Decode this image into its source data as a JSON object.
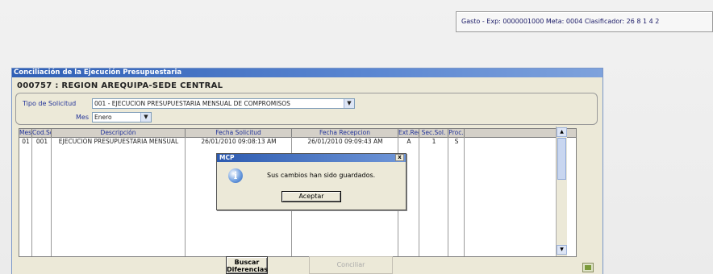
{
  "status_bar": {
    "text": "Gasto - Exp: 0000001000 Meta: 0004 Clasificador: 26 8 1 4 2"
  },
  "window": {
    "title": "Conciliación de la Ejecución Presupuestaria",
    "org_title": "000757 : REGION AREQUIPA-SEDE CENTRAL"
  },
  "filters": {
    "tipo_label": "Tipo de Solicitud",
    "tipo_value": "001 - EJECUCION PRESUPUESTARIA MENSUAL DE COMPROMISOS",
    "mes_label": "Mes",
    "mes_value": "Enero"
  },
  "grid": {
    "columns": [
      "Mes",
      "Cod.Sol.",
      "Descripción",
      "Fecha Solicitud",
      "Fecha Recepcion",
      "Ext.Reg.",
      "Sec.Sol.",
      "Proc."
    ],
    "rows": [
      [
        "01",
        "001",
        "EJECUCION PRESUPUESTARIA MENSUAL",
        "26/01/2010 09:08:13 AM",
        "26/01/2010 09:09:43 AM",
        "A",
        "1",
        "S"
      ]
    ]
  },
  "dialog": {
    "title": "MCP",
    "close_glyph": "x",
    "message": "Sus cambios han sido guardados.",
    "ok_label": "Aceptar",
    "icon_glyph": "i"
  },
  "buttons": {
    "buscar_line1": "Buscar",
    "buscar_line2": "Diferencias",
    "conciliar_label": "Conciliar"
  },
  "scroll_glyphs": {
    "up": "▲",
    "down": "▼",
    "combo_arrow": "▼"
  },
  "icons": {
    "info": "info-icon",
    "close": "close-icon",
    "export": "export-icon"
  },
  "colors": {
    "title_blue": "#2f5fb5",
    "label_blue": "#223399",
    "window_bg": "#ece9d8"
  }
}
